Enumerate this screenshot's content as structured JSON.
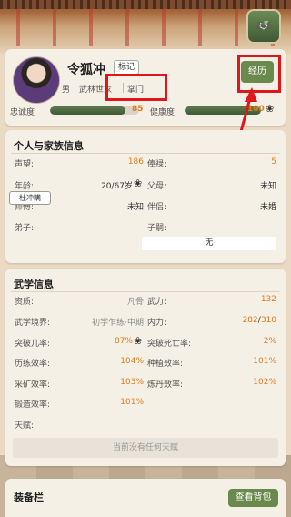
{
  "nav": {
    "back_label": "返回"
  },
  "profile": {
    "name": "令狐冲",
    "tag_label": "标记",
    "gender": "男",
    "family": "武林世家",
    "rank": "掌门",
    "experience_label": "经历",
    "loyalty_label": "忠诚度",
    "loyalty_value": "85",
    "loyalty_fraction": 0.85,
    "health_label": "健康度",
    "health_value": "100",
    "health_fraction": 1.0
  },
  "personal": {
    "title": "个人与家族信息",
    "prestige_label": "声望:",
    "prestige_value": "186",
    "salary_label": "俸禄:",
    "salary_value": "5",
    "age_label": "年龄:",
    "age_value": "20/67岁",
    "parents_label": "父母:",
    "parents_value": "未知",
    "master_label": "师傅:",
    "master_value": "未知",
    "partner_label": "伴侣:",
    "partner_value": "未婚",
    "disciple_label": "弟子:",
    "disciple_name": "杜冲瞒",
    "heir_label": "子嗣:",
    "heir_value": "无"
  },
  "martial": {
    "title": "武学信息",
    "aptitude_label": "资质:",
    "aptitude_value": "凡骨",
    "force_label": "武力:",
    "force_value": "132",
    "realm_label": "武学境界:",
    "realm_value": "初学乍练·中期",
    "inner_label": "内力:",
    "inner_value_cur": "282",
    "inner_value_sep": "/",
    "inner_value_max": "310",
    "breakthrough_label": "突破几率:",
    "breakthrough_value": "87%",
    "death_label": "突破死亡率:",
    "death_value": "2%",
    "train_label": "历练效率:",
    "train_value": "104%",
    "plant_label": "种植效率:",
    "plant_value": "101%",
    "mine_label": "采矿效率:",
    "mine_value": "103%",
    "alchemy_label": "炼丹效率:",
    "alchemy_value": "102%",
    "forge_label": "锻造效率:",
    "forge_value": "101%",
    "talent_label": "天赋:",
    "talent_empty": "当前没有任何天赋"
  },
  "equipment": {
    "title": "装备栏",
    "bag_button": "查看背包"
  },
  "colors": {
    "accent_green": "#6a8a4d",
    "value_orange": "#e07a1c",
    "highlight_red": "#e0161b"
  }
}
